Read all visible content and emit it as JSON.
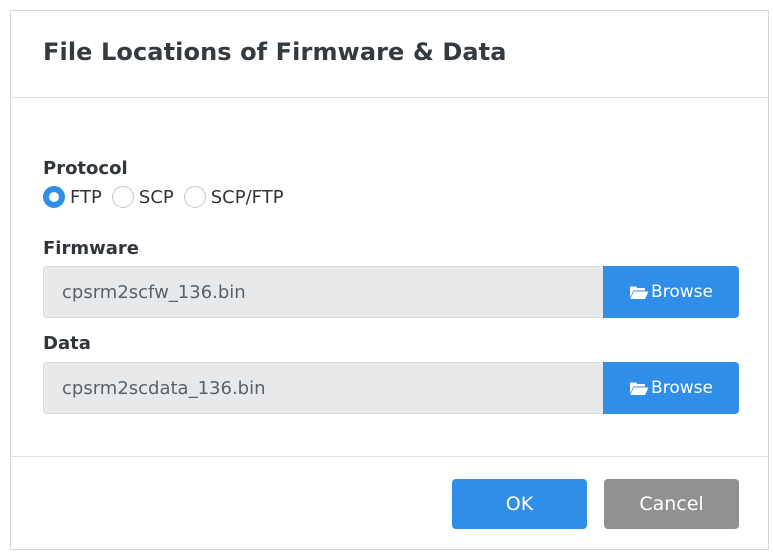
{
  "dialog": {
    "title": "File Locations of Firmware & Data"
  },
  "protocol": {
    "label": "Protocol",
    "options": [
      {
        "label": "FTP",
        "checked": true
      },
      {
        "label": "SCP",
        "checked": false
      },
      {
        "label": "SCP/FTP",
        "checked": false
      }
    ]
  },
  "firmware": {
    "label": "Firmware",
    "value": "cpsrm2scfw_136.bin",
    "browse_label": "Browse"
  },
  "data_file": {
    "label": "Data",
    "value": "cpsrm2scdata_136.bin",
    "browse_label": "Browse"
  },
  "footer": {
    "ok_label": "OK",
    "cancel_label": "Cancel"
  },
  "colors": {
    "accent": "#2f8ee8",
    "cancel": "#909191",
    "input_bg": "#e8e9ea"
  },
  "icons": {
    "browse": "folder-open-icon"
  }
}
